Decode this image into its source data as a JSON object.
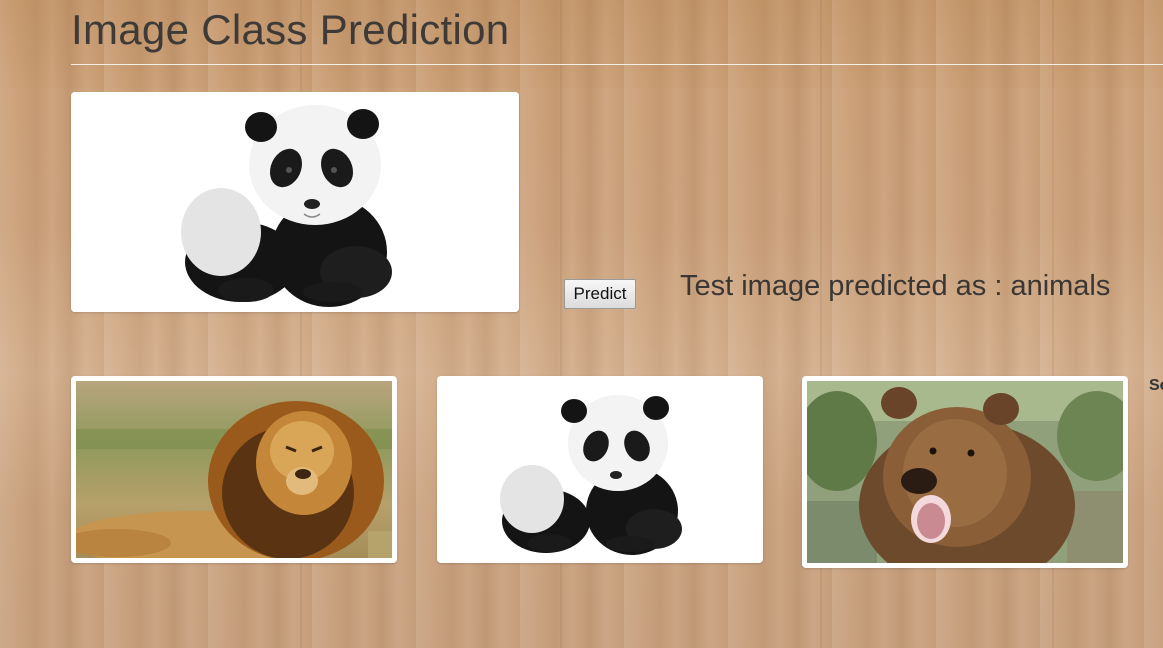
{
  "page": {
    "title": "Image Class Prediction"
  },
  "upload": {
    "preview_image": "panda-cub-image"
  },
  "actions": {
    "predict_label": "Predict"
  },
  "result": {
    "text": "Test image predicted as : animals"
  },
  "gallery": {
    "items": [
      {
        "image": "lion-image"
      },
      {
        "image": "panda-cub-image"
      },
      {
        "image": "brown-bear-image"
      }
    ],
    "side_label": "Se"
  },
  "colors": {
    "background": "#c79a72",
    "title_text": "#3d3a38",
    "rule": "#f4ede6",
    "card": "#ffffff"
  }
}
